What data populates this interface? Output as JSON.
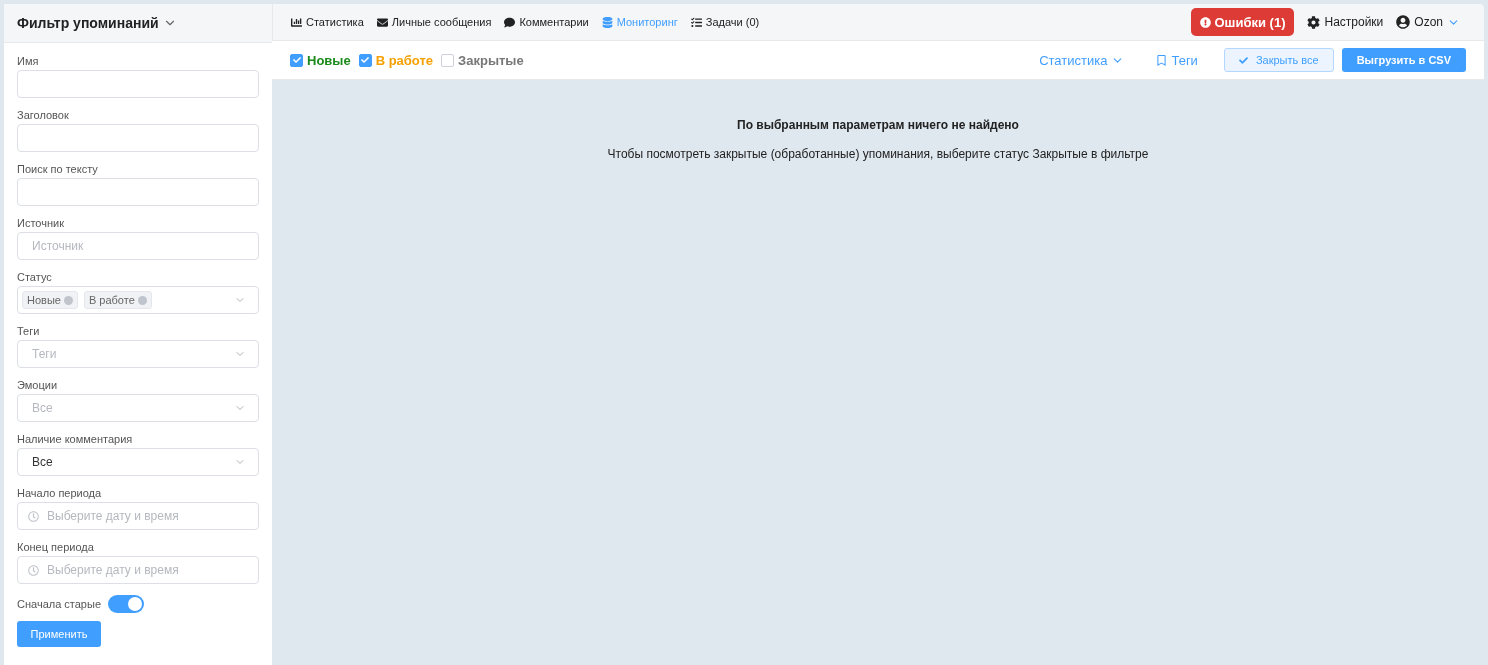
{
  "sidebar": {
    "title": "Фильтр упоминаний",
    "fields": [
      {
        "kind": "input",
        "label": "Имя"
      },
      {
        "kind": "input",
        "label": "Заголовок"
      },
      {
        "kind": "input",
        "label": "Поиск по тексту"
      },
      {
        "kind": "input",
        "label": "Источник",
        "placeholder": "Источник"
      },
      {
        "kind": "tags",
        "label": "Статус",
        "tags": [
          "Новые",
          "В работе"
        ]
      },
      {
        "kind": "select",
        "label": "Теги",
        "placeholder": "Теги"
      },
      {
        "kind": "select",
        "label": "Эмоции",
        "placeholder": "Все"
      },
      {
        "kind": "select",
        "label": "Наличие комментария",
        "value": "Все"
      },
      {
        "kind": "date",
        "label": "Начало периода",
        "placeholder": "Выберите дату и время"
      },
      {
        "kind": "date",
        "label": "Конец периода",
        "placeholder": "Выберите дату и время"
      }
    ],
    "toggle": {
      "label": "Сначала старые",
      "on": true
    },
    "apply_button": "Применить"
  },
  "nav": {
    "items": [
      {
        "label": "Статистика",
        "selected": false
      },
      {
        "label": "Личные сообщения",
        "selected": false
      },
      {
        "label": "Комментарии",
        "selected": false
      },
      {
        "label": "Мониторинг",
        "selected": true
      },
      {
        "label": "Задачи (0)",
        "selected": false
      }
    ],
    "errors_button": "Ошибки (1)",
    "settings": "Настройки",
    "user": "Ozon"
  },
  "toolbar": {
    "statuses": [
      {
        "label": "Новые",
        "checked": true,
        "color": "#1a8a1a"
      },
      {
        "label": "В работе",
        "checked": true,
        "color": "#f5a000"
      },
      {
        "label": "Закрытые",
        "checked": false,
        "color": "#777777"
      }
    ],
    "statistics_menu": "Статистика",
    "tags_link": "Теги",
    "close_all_button": "Закрыть все",
    "export_button": "Выгрузить в CSV"
  },
  "empty_state": {
    "title": "По выбранным параметрам ничего не найдено",
    "hint": "Чтобы посмотреть закрытые (обработанные) упоминания, выберите статус Закрытые в фильтре"
  }
}
